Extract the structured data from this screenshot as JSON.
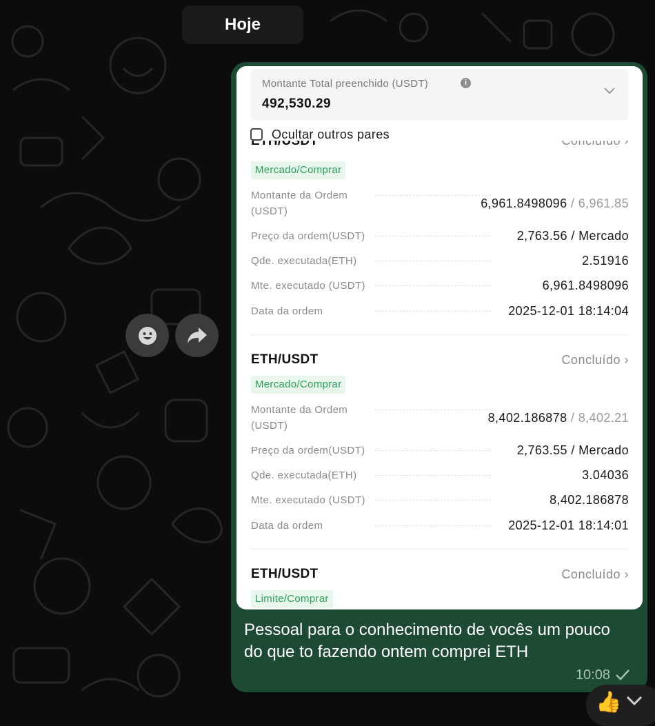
{
  "date_divider": "Hoje",
  "screenshot": {
    "total_label": "Montante Total preenchido (USDT)",
    "total_value": "492,530.29",
    "hide_pairs_label": "Ocultar outros pares",
    "partial_pair": "ETH/USDT",
    "partial_status": "Concluído",
    "orders": [
      {
        "tag": "Mercado/Comprar",
        "rows": [
          {
            "label": "Montante da Ordem\n(USDT)",
            "value": "6,961.8498096",
            "value_extra": " / 6,961.85"
          },
          {
            "label": "Preço da ordem(USDT)",
            "value": "2,763.56 / Mercado"
          },
          {
            "label": "Qde. executada(ETH)",
            "value": "2.51916"
          },
          {
            "label": "Mte. executado (USDT)",
            "value": "6,961.8498096"
          },
          {
            "label": "Data da ordem",
            "value": "2025-12-01 18:14:04"
          }
        ]
      },
      {
        "pair": "ETH/USDT",
        "status": "Concluído",
        "tag": "Mercado/Comprar",
        "rows": [
          {
            "label": "Montante da Ordem\n(USDT)",
            "value": "8,402.186878",
            "value_extra": " / 8,402.21"
          },
          {
            "label": "Preço da ordem(USDT)",
            "value": "2,763.55 / Mercado"
          },
          {
            "label": "Qde. executada(ETH)",
            "value": "3.04036"
          },
          {
            "label": "Mte. executado (USDT)",
            "value": "8,402.186878"
          },
          {
            "label": "Data da ordem",
            "value": "2025-12-01 18:14:01"
          }
        ]
      },
      {
        "pair": "ETH/USDT",
        "status": "Concluído",
        "tag": "Limite/Comprar"
      }
    ]
  },
  "message_text": "Pessoal para o conhecimento de vocês um pouco do que to fazendo ontem comprei ETH",
  "message_time": "10:08",
  "reaction_emoji": "👍",
  "icons": {
    "react": "emoji-icon",
    "forward": "forward-arrow-icon",
    "sent": "single-check-icon",
    "scroll": "chevron-down-icon"
  },
  "colors": {
    "bubble": "#1d4a33",
    "tag_bg": "#e8f6ec",
    "tag_text": "#27a05a"
  }
}
